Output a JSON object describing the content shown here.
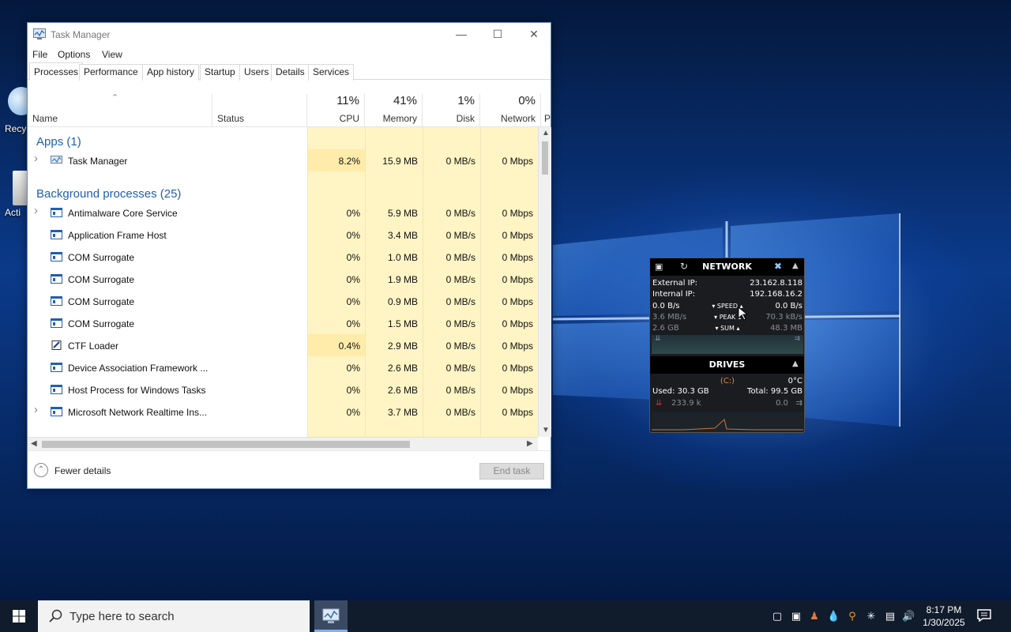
{
  "desktop": {
    "icons": [
      {
        "label": "Recy",
        "icon": "recycle-bin-icon"
      },
      {
        "label": "Acti",
        "icon": "folder-icon"
      }
    ]
  },
  "task_manager": {
    "title": "Task Manager",
    "menu": [
      "File",
      "Options",
      "View"
    ],
    "tabs": [
      "Processes",
      "Performance",
      "App history",
      "Startup",
      "Users",
      "Details",
      "Services"
    ],
    "active_tab": "Processes",
    "columns": {
      "name": "Name",
      "status": "Status",
      "cpu": {
        "pct": "11%",
        "label": "CPU"
      },
      "memory": {
        "pct": "41%",
        "label": "Memory"
      },
      "disk": {
        "pct": "1%",
        "label": "Disk"
      },
      "network": {
        "pct": "0%",
        "label": "Network"
      },
      "extra": "P"
    },
    "groups": {
      "apps": "Apps (1)",
      "background": "Background processes (25)"
    },
    "rows": [
      {
        "name": "Task Manager",
        "cpu": "8.2%",
        "mem": "15.9 MB",
        "disk": "0 MB/s",
        "net": "0 Mbps",
        "expand": true,
        "icon": "task-manager-icon"
      },
      {
        "name": "Antimalware Core Service",
        "cpu": "0%",
        "mem": "5.9 MB",
        "disk": "0 MB/s",
        "net": "0 Mbps",
        "expand": true,
        "icon": "service-icon"
      },
      {
        "name": "Application Frame Host",
        "cpu": "0%",
        "mem": "3.4 MB",
        "disk": "0 MB/s",
        "net": "0 Mbps",
        "expand": false,
        "icon": "service-icon"
      },
      {
        "name": "COM Surrogate",
        "cpu": "0%",
        "mem": "1.0 MB",
        "disk": "0 MB/s",
        "net": "0 Mbps",
        "expand": false,
        "icon": "service-icon"
      },
      {
        "name": "COM Surrogate",
        "cpu": "0%",
        "mem": "1.9 MB",
        "disk": "0 MB/s",
        "net": "0 Mbps",
        "expand": false,
        "icon": "service-icon"
      },
      {
        "name": "COM Surrogate",
        "cpu": "0%",
        "mem": "0.9 MB",
        "disk": "0 MB/s",
        "net": "0 Mbps",
        "expand": false,
        "icon": "service-icon"
      },
      {
        "name": "COM Surrogate",
        "cpu": "0%",
        "mem": "1.5 MB",
        "disk": "0 MB/s",
        "net": "0 Mbps",
        "expand": false,
        "icon": "service-icon"
      },
      {
        "name": "CTF Loader",
        "cpu": "0.4%",
        "mem": "2.9 MB",
        "disk": "0 MB/s",
        "net": "0 Mbps",
        "expand": false,
        "icon": "ctf-loader-icon"
      },
      {
        "name": "Device Association Framework ...",
        "cpu": "0%",
        "mem": "2.6 MB",
        "disk": "0 MB/s",
        "net": "0 Mbps",
        "expand": false,
        "icon": "service-icon"
      },
      {
        "name": "Host Process for Windows Tasks",
        "cpu": "0%",
        "mem": "2.6 MB",
        "disk": "0 MB/s",
        "net": "0 Mbps",
        "expand": false,
        "icon": "service-icon"
      },
      {
        "name": "Microsoft Network Realtime Ins...",
        "cpu": "0%",
        "mem": "3.7 MB",
        "disk": "0 MB/s",
        "net": "0 Mbps",
        "expand": true,
        "icon": "service-icon"
      }
    ],
    "footer": {
      "fewer_details": "Fewer details",
      "end_task": "End task"
    }
  },
  "gadget": {
    "network": {
      "title": "NETWORK",
      "external_ip_label": "External IP:",
      "external_ip": "23.162.8.118",
      "internal_ip_label": "Internal IP:",
      "internal_ip": "192.168.16.2",
      "speed_down": "0.0 B/s",
      "speed_label": "SPEED",
      "speed_up": "0.0 B/s",
      "peak_down": "3.6 MB/s",
      "peak_label": "PEAK",
      "peak_up": "70.3 kB/s",
      "sum_down": "2.6 GB",
      "sum_label": "SUM",
      "sum_up": "48.3 MB"
    },
    "drives": {
      "title": "DRIVES",
      "drive": "(C:)",
      "temp": "0°C",
      "used": "Used: 30.3 GB",
      "total": "Total: 99.5 GB",
      "read": "233.9 k",
      "write": "0.0"
    }
  },
  "taskbar": {
    "search_placeholder": "Type here to search",
    "time": "8:17 PM",
    "date": "1/30/2025"
  },
  "colors": {
    "usage_light": "#fff4c4",
    "usage_medium": "#ffe9a8",
    "group_text": "#1f5fb0"
  }
}
